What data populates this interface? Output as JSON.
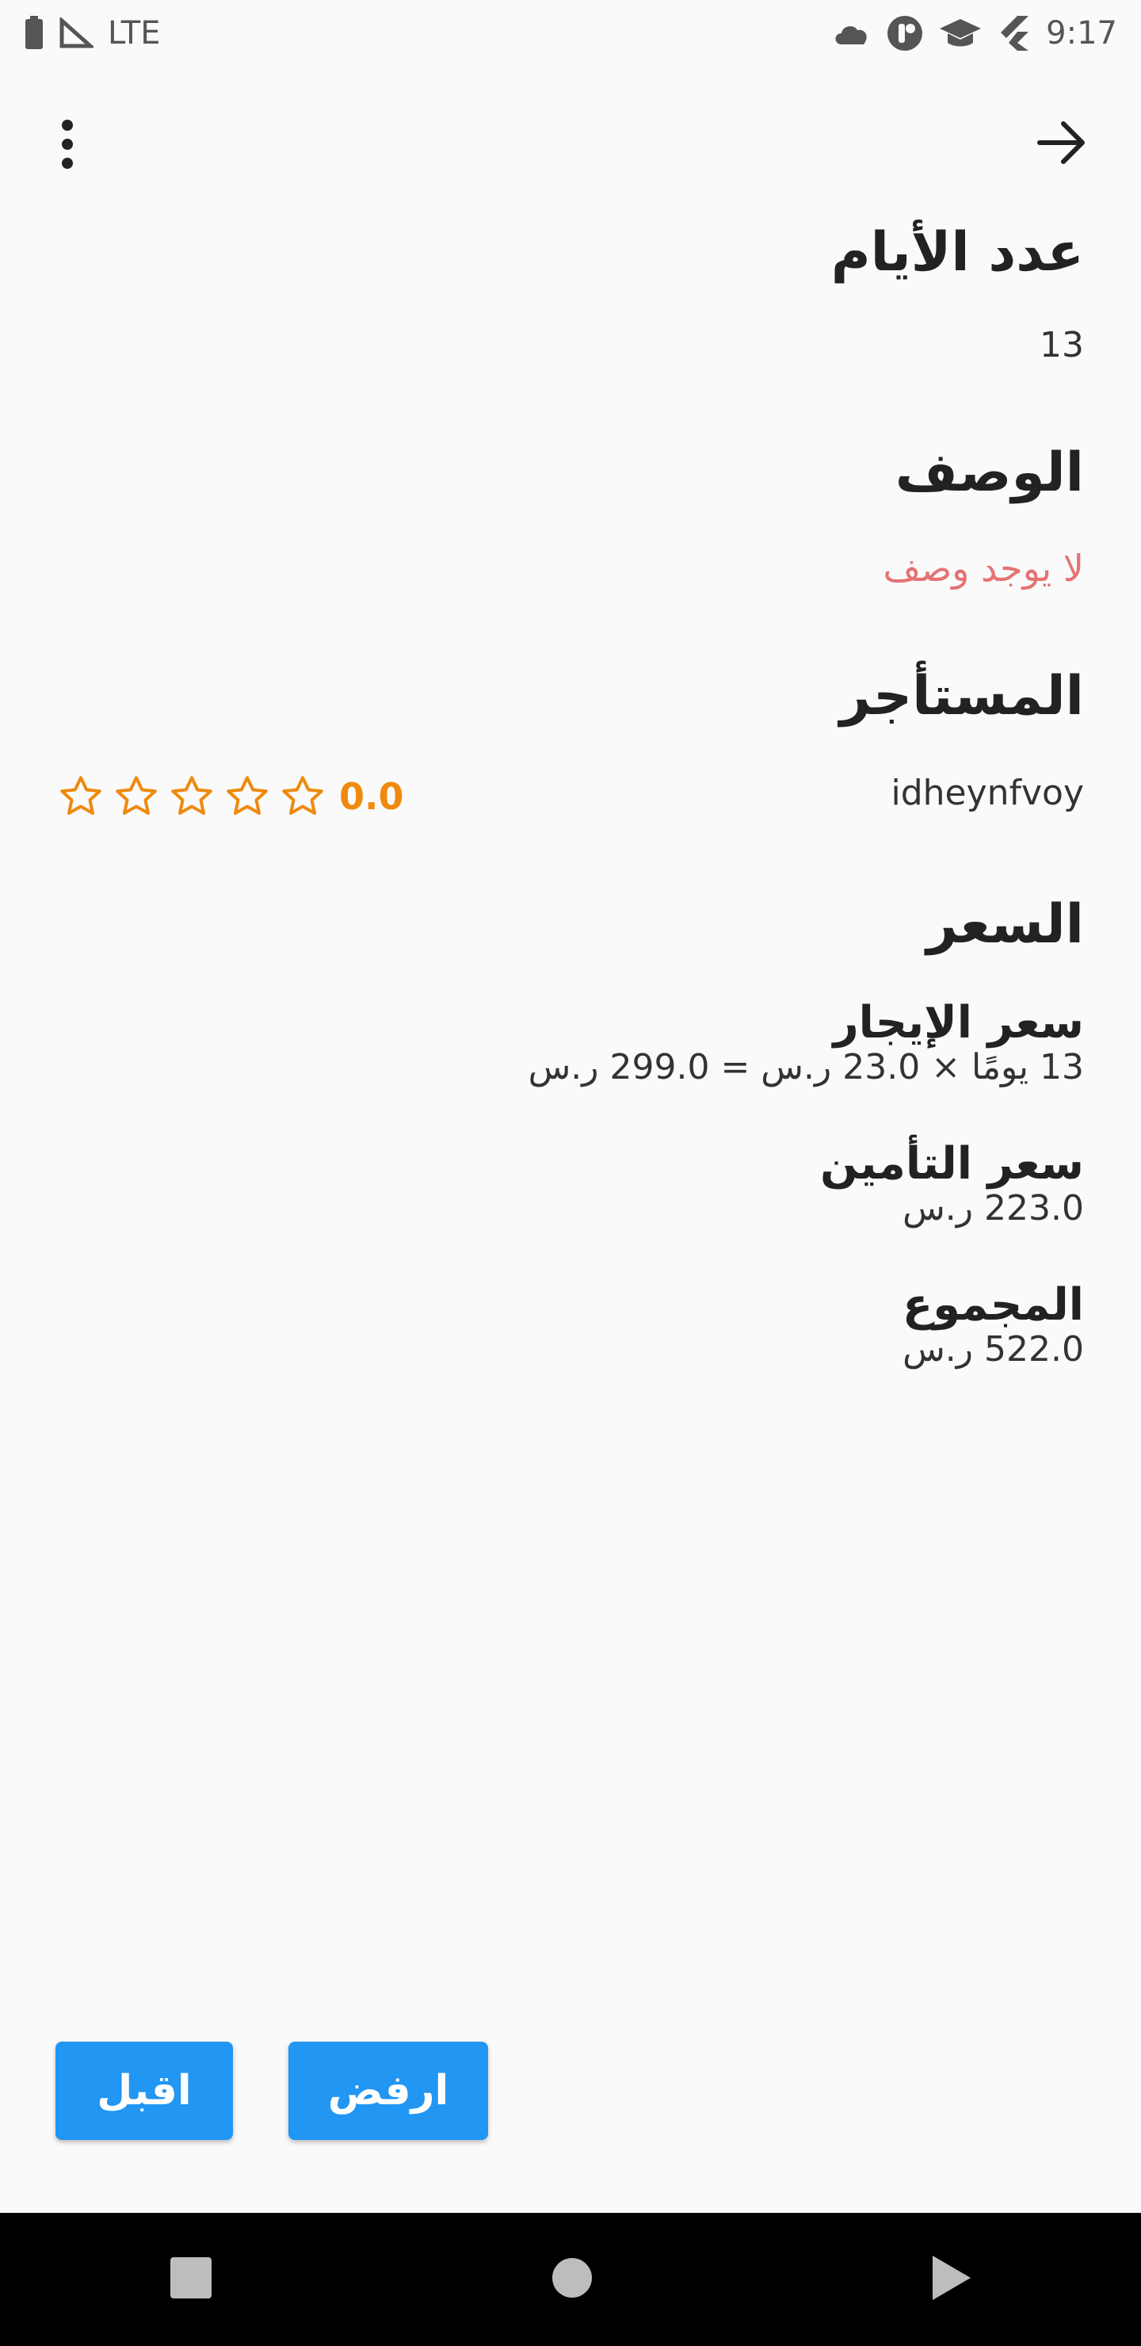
{
  "status_bar": {
    "network": "LTE",
    "time": "9:17"
  },
  "details": {
    "days_heading": "عدد الأيام",
    "days_value": "13",
    "description_heading": "الوصف",
    "description_value": "لا يوجد وصف",
    "renter_heading": "المستأجر",
    "renter_name": "idheynfvoy",
    "renter_rating": "0.0",
    "renter_rating_stars": 0
  },
  "price": {
    "heading": "السعر",
    "rent_label": "سعر الإيجار",
    "rent_value": "13 يومًا × 23.0 ر.س = 299.0 ر.س",
    "insurance_label": "سعر التأمين",
    "insurance_value": "223.0 ر.س",
    "total_label": "المجموع",
    "total_value": "522.0 ر.س"
  },
  "actions": {
    "accept_label": "اقبل",
    "reject_label": "ارفض"
  },
  "colors": {
    "accent": "#2196f3",
    "rating": "#ef8a0e",
    "empty_description": "#e57373"
  }
}
